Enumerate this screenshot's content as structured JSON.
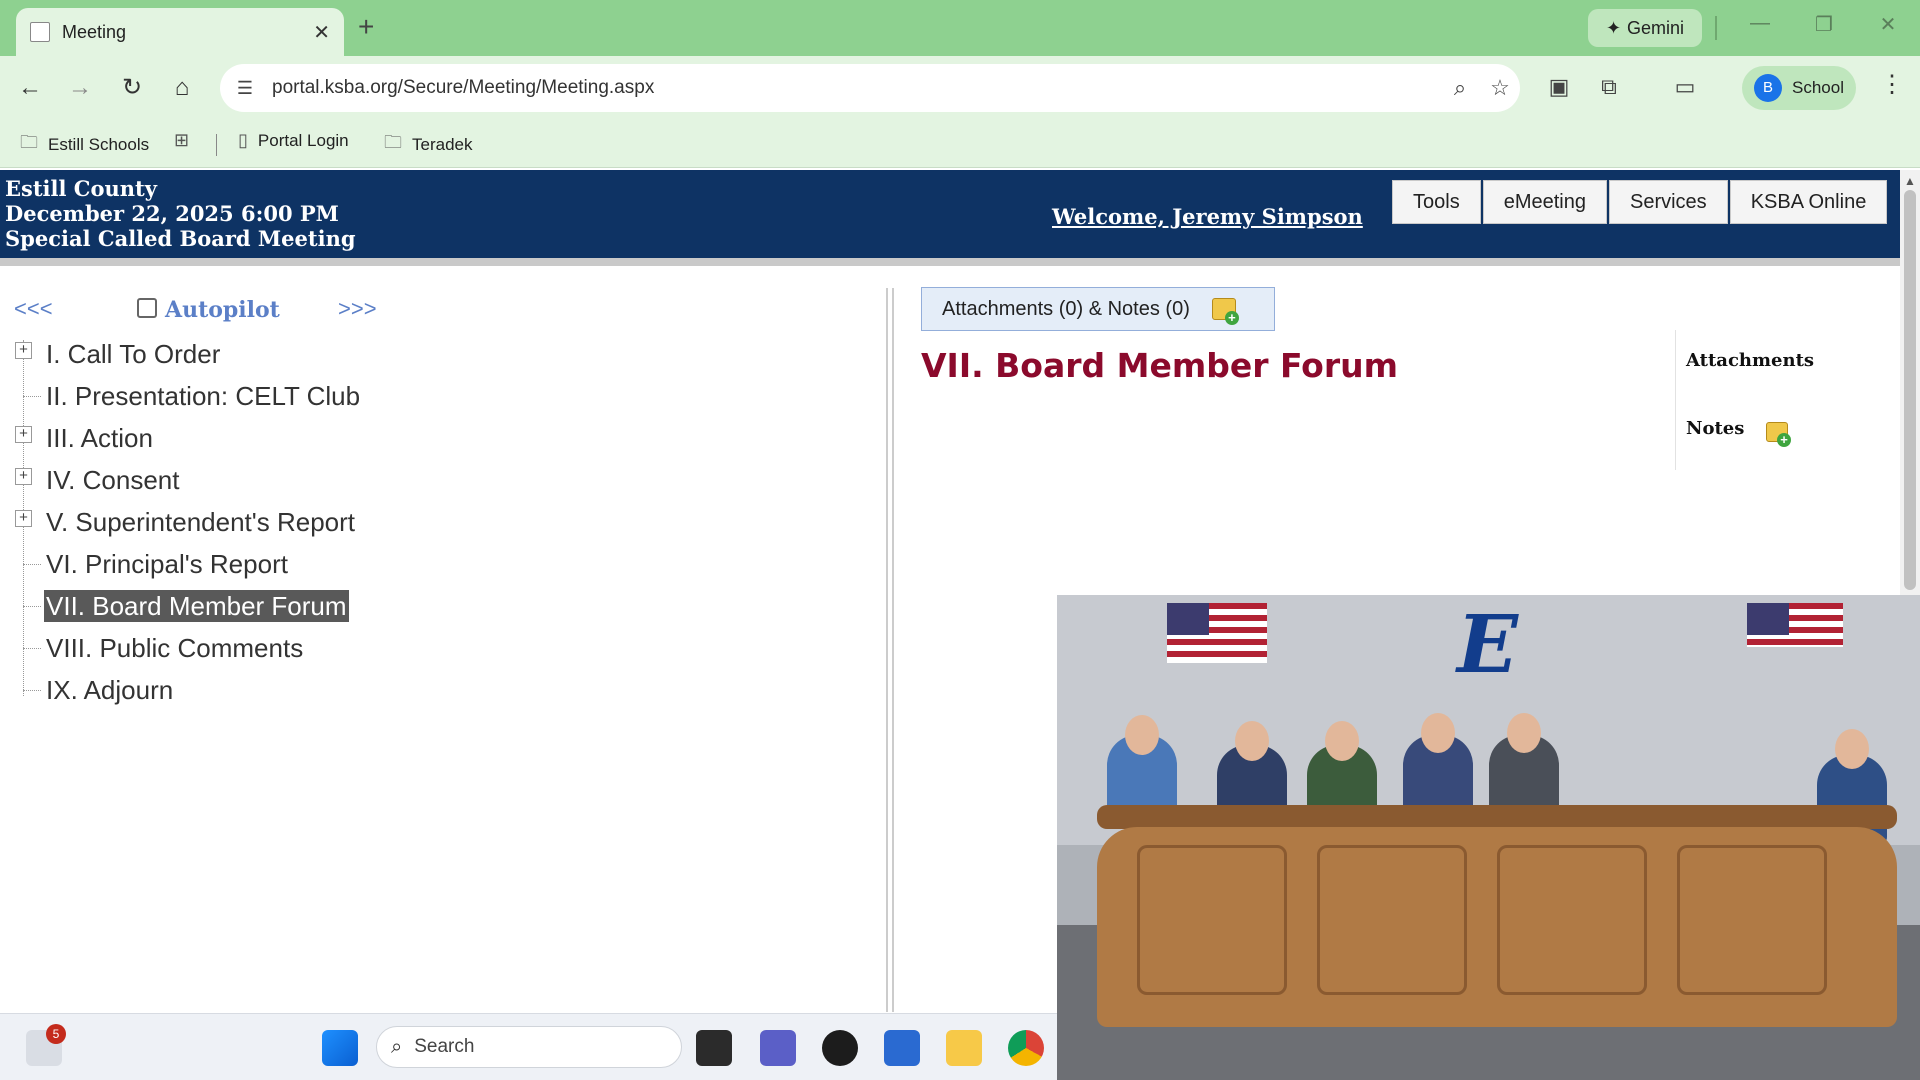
{
  "browser": {
    "tab_title": "Meeting",
    "new_tab": "+",
    "gemini_label": "Gemini",
    "url": "portal.ksba.org/Secure/Meeting/Meeting.aspx",
    "profile_initial": "B",
    "profile_label": "School",
    "bookmarks": [
      {
        "label": "Estill Schools",
        "icon": "folder-icon"
      },
      {
        "label": "Portal Login",
        "icon": "page-icon"
      },
      {
        "label": "Teradek",
        "icon": "folder-icon"
      }
    ]
  },
  "header": {
    "org": "Estill County",
    "date": "December 22, 2025 6:00 PM",
    "meeting": "Special Called Board Meeting",
    "welcome": "Welcome, Jeremy Simpson",
    "menu": [
      "Tools",
      "eMeeting",
      "Services",
      "KSBA Online"
    ]
  },
  "agenda_nav": {
    "prev": "<<<",
    "autopilot": "Autopilot",
    "next": ">>>"
  },
  "agenda": [
    {
      "label": "I. Call To Order",
      "expandable": true
    },
    {
      "label": "II. Presentation: CELT Club",
      "expandable": false
    },
    {
      "label": "III. Action",
      "expandable": true
    },
    {
      "label": "IV. Consent",
      "expandable": true
    },
    {
      "label": "V. Superintendent's Report",
      "expandable": true
    },
    {
      "label": "VI. Principal's Report",
      "expandable": false
    },
    {
      "label": "VII. Board Member Forum",
      "expandable": false,
      "selected": true
    },
    {
      "label": "VIII. Public Comments",
      "expandable": false
    },
    {
      "label": "IX. Adjourn",
      "expandable": false
    }
  ],
  "detail": {
    "attachments_button": "Attachments (0) & Notes (0)",
    "title": "VII. Board Member Forum",
    "side_attachments": "Attachments",
    "side_notes": "Notes"
  },
  "taskbar": {
    "notification_count": "5",
    "search_placeholder": "Search"
  },
  "colors": {
    "header_bg": "#0e3364",
    "title_color": "#8b0a2c",
    "link_color": "#5b7fc7",
    "chrome_green": "#8ed190"
  }
}
